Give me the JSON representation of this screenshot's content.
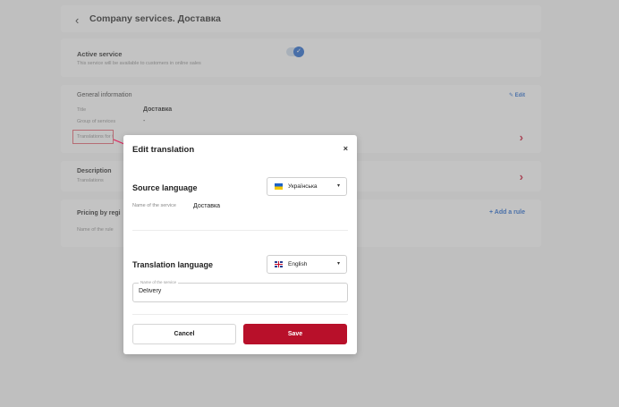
{
  "header": {
    "back_icon": "‹",
    "title": "Company services. Доставка"
  },
  "active_service": {
    "title": "Active service",
    "subtitle": "This service will be available to customers in online sales",
    "toggle_on": true
  },
  "general": {
    "title": "General information",
    "edit_label": "Edit",
    "title_label": "Title",
    "title_value": "Доставка",
    "group_label": "Group of services",
    "group_value": "-",
    "translations_label": "Translations for t"
  },
  "description": {
    "title": "Description",
    "subtitle": "Translations"
  },
  "pricing": {
    "title": "Pricing by regi",
    "subtitle": "Name of the rule",
    "add_label": "+ Add a rule"
  },
  "modal": {
    "title": "Edit translation",
    "close": "×",
    "source": {
      "title": "Source language",
      "language": "Українська",
      "field_label": "Name of the service",
      "field_value": "Доставка"
    },
    "translation": {
      "title": "Translation language",
      "language": "English",
      "field_label": "Name of the service",
      "field_value": "Delivery"
    },
    "cancel_label": "Cancel",
    "save_label": "Save"
  },
  "colors": {
    "accent": "#1c62c8",
    "primary_button": "#b8102a",
    "chevron": "#c8102e"
  }
}
